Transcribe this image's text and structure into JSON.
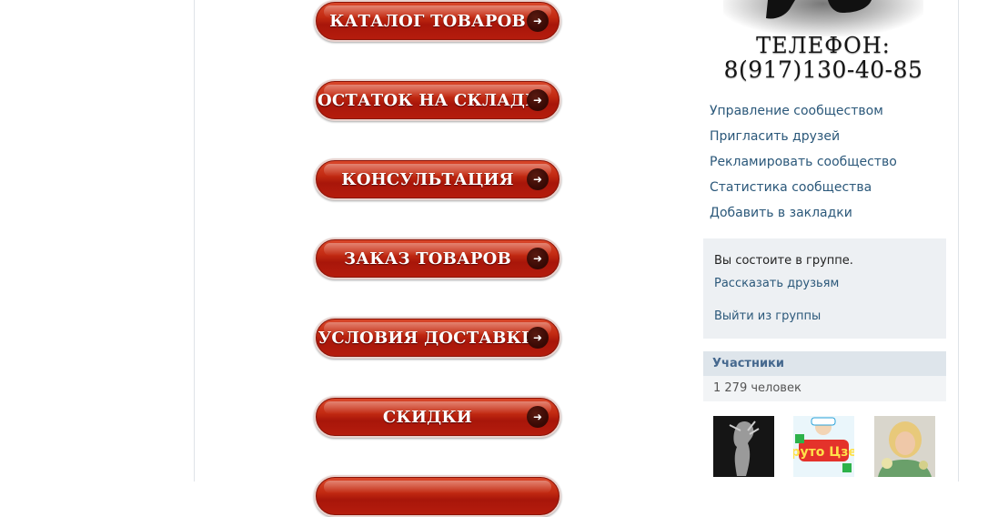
{
  "menu": {
    "buttons": [
      {
        "label": "КАТАЛОГ ТОВАРОВ"
      },
      {
        "label": "ОСТАТОК НА СКЛАДЕ"
      },
      {
        "label": "КОНСУЛЬТАЦИЯ"
      },
      {
        "label": "ЗАКАЗ ТОВАРОВ"
      },
      {
        "label": "УСЛОВИЯ ДОСТАВКИ"
      },
      {
        "label": "СКИДКИ"
      },
      {
        "label": ""
      }
    ],
    "arrow_icon": "arrow-right-icon",
    "colors": {
      "button": "#b51c0d",
      "arrow_circle": "#3a0a05"
    }
  },
  "banner": {
    "phone_label": "ТЕЛЕФОН:",
    "phone_number": "8(917)130-40-85"
  },
  "sidebar_actions": {
    "manage": "Управление сообществом",
    "invite": "Пригласить друзей",
    "advertise": "Рекламировать сообщество",
    "stats": "Статистика сообщества",
    "bookmark": "Добавить в закладки"
  },
  "membership": {
    "status": "Вы состоите в группе.",
    "tell_friends": "Рассказать друзьям",
    "leave": "Выйти из группы"
  },
  "members": {
    "title": "Участники",
    "count": "1 279 человек",
    "thumbnails": [
      {
        "alt": "member-photo-1"
      },
      {
        "alt": "member-photo-2",
        "logo_text": "Круто Цзер"
      },
      {
        "alt": "member-photo-3"
      }
    ]
  }
}
